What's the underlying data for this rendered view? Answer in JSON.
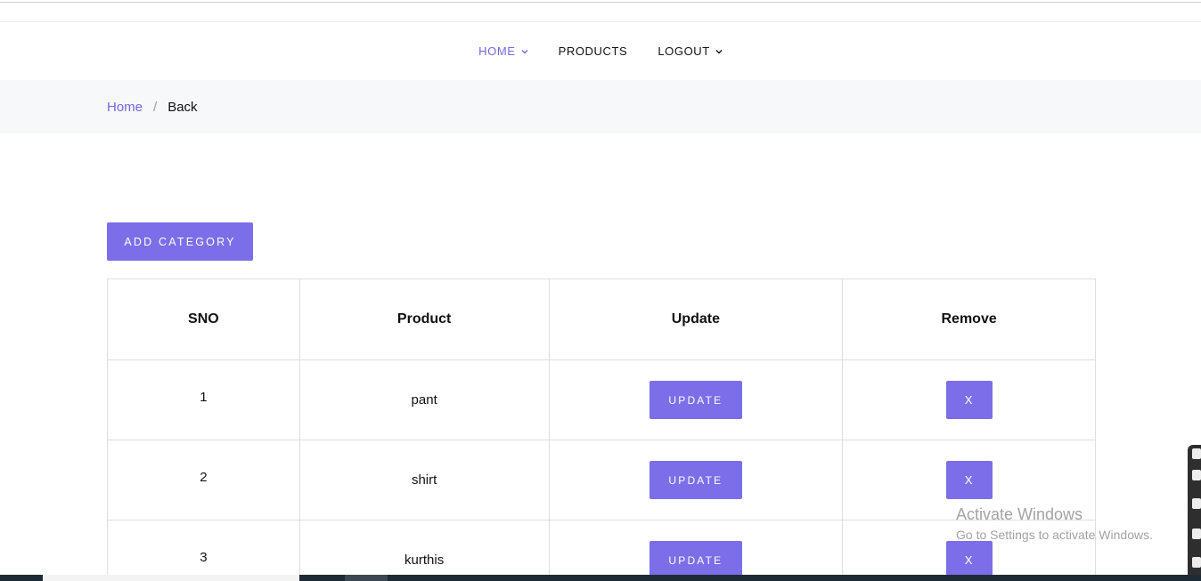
{
  "nav": {
    "items": [
      {
        "label": "HOME",
        "has_dropdown": true,
        "active": true
      },
      {
        "label": "PRODUCTS",
        "has_dropdown": false,
        "active": false
      },
      {
        "label": "LOGOUT",
        "has_dropdown": true,
        "active": false
      }
    ]
  },
  "breadcrumb": {
    "home": "Home",
    "separator": "/",
    "current": "Back"
  },
  "actions": {
    "add_category": "ADD CATEGORY"
  },
  "table": {
    "headers": [
      "SNO",
      "Product",
      "Update",
      "Remove"
    ],
    "rows": [
      {
        "sno": "1",
        "product": "pant",
        "update": "UPDATE",
        "remove": "X"
      },
      {
        "sno": "2",
        "product": "shirt",
        "update": "UPDATE",
        "remove": "X"
      },
      {
        "sno": "3",
        "product": "kurthis",
        "update": "UPDATE",
        "remove": "X"
      }
    ]
  },
  "watermark": {
    "title": "Activate Windows",
    "subtitle": "Go to Settings to activate Windows."
  },
  "colors": {
    "accent": "#7b6ee8",
    "accent_text": "#7367e8",
    "breadcrumb_bg": "#f7f8fa",
    "border": "#dedede"
  },
  "icons": {
    "nav_dropdown": "chevron-down-icon"
  }
}
